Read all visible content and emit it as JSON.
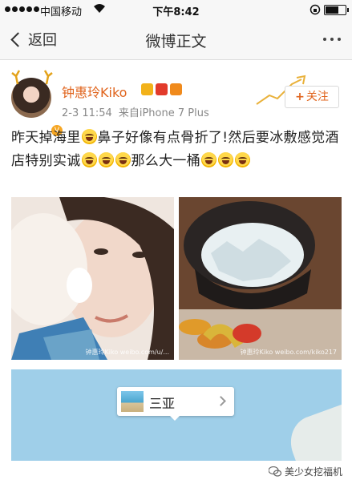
{
  "status_bar": {
    "carrier": "中国移动",
    "time": "下午8:42"
  },
  "nav": {
    "back_label": "返回",
    "title": "微博正文"
  },
  "post": {
    "username": "钟惠玲Kiko",
    "date": "2-3 11:54",
    "source": "来自iPhone 7 Plus",
    "follow_label": "关注",
    "text_segments": [
      "昨天掉海里",
      "鼻子好像有点骨折了!然后要冰敷感觉酒店特别实诚",
      "那么大一桶",
      ""
    ],
    "emoji_name": "laughing-emoji"
  },
  "photos": [
    {
      "watermark": "钟惠玲Kiko weibo.com/u/..."
    },
    {
      "watermark": "钟惠玲Kiko weibo.com/kiko217"
    }
  ],
  "location": {
    "name": "三亚"
  },
  "footer": {
    "watermark": "美少女挖福机"
  },
  "colors": {
    "accent": "#e0641d",
    "map_water": "#9fcfe9",
    "meta_gray": "#888888"
  }
}
